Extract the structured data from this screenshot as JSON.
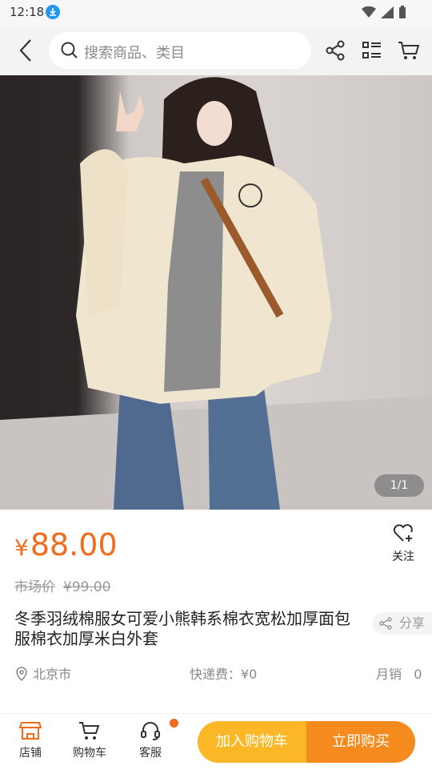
{
  "status": {
    "time": "12:18"
  },
  "search": {
    "placeholder": "搜索商品、类目"
  },
  "gallery": {
    "counter": "1/1"
  },
  "product": {
    "price_symbol": "¥",
    "price": "88.00",
    "market_label": "市场价",
    "market_price": "¥99.00",
    "title": "冬季羽绒棉服女可爱小熊韩系棉衣宽松加厚面包服棉衣加厚米白外套",
    "share_label": "分享",
    "follow_label": "关注",
    "location": "北京市",
    "shipping": "快递费：¥0",
    "monthly_sales": "月销   0"
  },
  "bottom": {
    "store": "店铺",
    "cart": "购物车",
    "service": "客服",
    "add_to_cart": "加入购物车",
    "buy_now": "立即购买"
  },
  "colors": {
    "accent": "#f26b1d",
    "cart_button": "#fbb725",
    "buy_button": "#f58a1f"
  }
}
